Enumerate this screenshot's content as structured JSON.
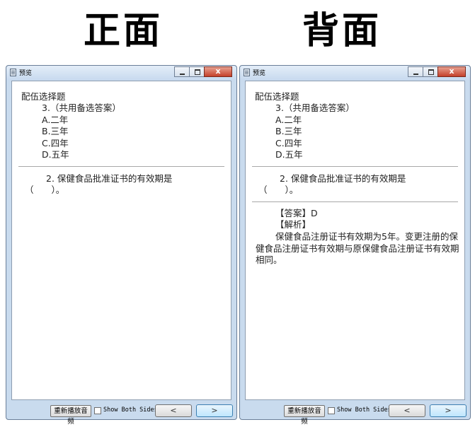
{
  "headings": {
    "front": "正面",
    "back": "背面"
  },
  "window": {
    "title": "预览",
    "replay_label": "重新播放音频",
    "show_both_label": "Show Both Sides",
    "prev_label": "<",
    "next_label": ">"
  },
  "question": {
    "type": "配伍选择题",
    "group": "3.（共用备选答案）",
    "options": [
      "A.二年",
      "B.三年",
      "C.四年",
      "D.五年"
    ],
    "stem_line1": "2. 保健食品批准证书的有效期是",
    "stem_line2": "（　　）。"
  },
  "answer": {
    "answer_line": "【答案】D",
    "analysis_label": "【解析】",
    "analysis_text": "保健食品注册证书有效期为5年。变更注册的保健食品注册证书有效期与原保健食品注册证书有效期相同。"
  },
  "colors": {
    "accent": "#3c7fb1",
    "close": "#c4402a",
    "frame": "#c9dbee"
  }
}
